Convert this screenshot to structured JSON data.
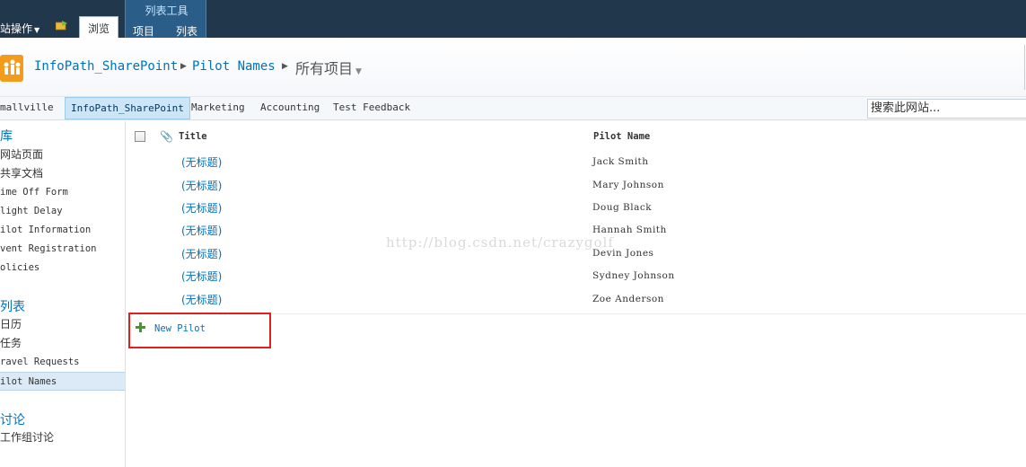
{
  "ribbon": {
    "site_actions": "站操作",
    "browse_tab": "浏览",
    "contextual_group_title": "列表工具",
    "items_tab": "项目",
    "list_tab": "列表"
  },
  "breadcrumb": {
    "site": "InfoPath_SharePoint",
    "list": "Pilot Names",
    "view": "所有项目"
  },
  "topnav": {
    "items": [
      "mallville",
      "InfoPath_SharePoint",
      "Marketing",
      "Accounting",
      "Test Feedback"
    ],
    "selected_index": 1,
    "search_placeholder": "搜索此网站..."
  },
  "quicklaunch": {
    "libraries_heading": "库",
    "libraries": [
      "网站页面",
      "共享文档",
      "ime Off Form",
      "light Delay",
      "ilot Information",
      "vent Registration",
      "olicies"
    ],
    "lists_heading": "列表",
    "lists": [
      "日历",
      "任务",
      "ravel Requests",
      "ilot Names"
    ],
    "discussions_heading": "讨论",
    "discussions": [
      "工作组讨论"
    ]
  },
  "list": {
    "columns": [
      "Title",
      "Pilot Name"
    ],
    "rows": [
      {
        "title": "(无标题)",
        "pilot": "Jack Smith"
      },
      {
        "title": "(无标题)",
        "pilot": "Mary Johnson"
      },
      {
        "title": "(无标题)",
        "pilot": "Doug Black"
      },
      {
        "title": "(无标题)",
        "pilot": "Hannah Smith"
      },
      {
        "title": "(无标题)",
        "pilot": "Devin Jones"
      },
      {
        "title": "(无标题)",
        "pilot": "Sydney Johnson"
      },
      {
        "title": "(无标题)",
        "pilot": "Zoe Anderson"
      }
    ],
    "new_item_label": "New Pilot"
  },
  "watermark": "http://blog.csdn.net/crazygolf",
  "colors": {
    "ribbon_bg": "#21374c",
    "link": "#0072bc",
    "highlight_box": "#e01f1f",
    "logo": "#f29b1c"
  }
}
